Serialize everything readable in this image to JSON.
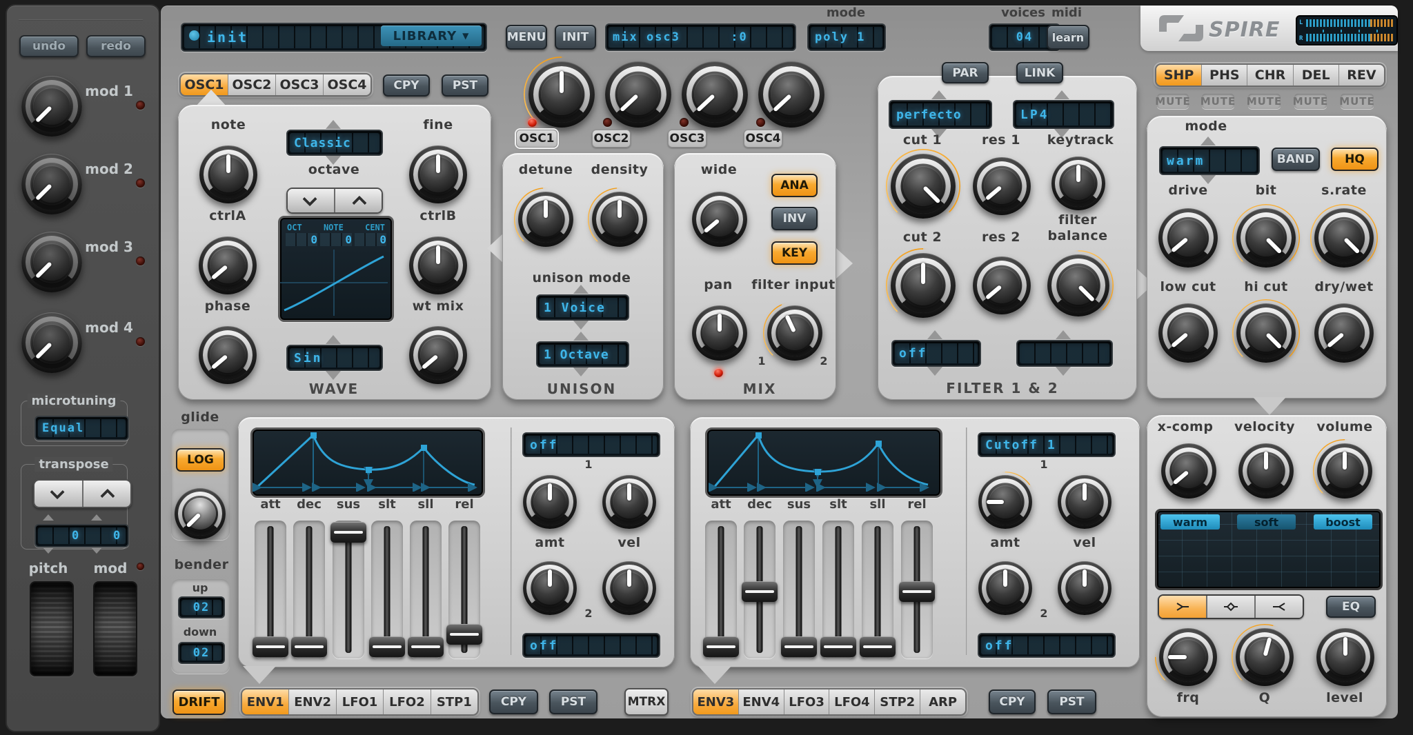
{
  "colors": {
    "accent_orange": "#f29a12",
    "lcd_cyan": "#3fb6ea",
    "lcd_bg": "#0c161d",
    "panel_gray": "#d6d6d6",
    "sidebar_gray": "#4b4b4b"
  },
  "sidebar": {
    "undo": "undo",
    "redo": "redo",
    "mods": [
      "mod 1",
      "mod 2",
      "mod 3",
      "mod 4"
    ],
    "microtuning_label": "microtuning",
    "microtuning_value": "Equal",
    "transpose_label": "transpose",
    "transpose_left": "0",
    "transpose_right": "0",
    "pitch_label": "pitch",
    "mod_label": "mod"
  },
  "topbar": {
    "preset": "init",
    "library": "LIBRARY",
    "library_caret": "▼",
    "menu": "MENU",
    "init": "INIT",
    "info": "mix osc3      :0",
    "mode_label": "mode",
    "mode_value": "poly 1",
    "voices_label": "voices",
    "voices_value": "04",
    "midi_label": "midi",
    "learn": "learn"
  },
  "logo": {
    "brand": "SPIRE",
    "meter_left": "L",
    "meter_right": "R"
  },
  "osc": {
    "tabs": [
      "OSC1",
      "OSC2",
      "OSC3",
      "OSC4"
    ],
    "copy": "CPY",
    "paste": "PST",
    "mixer_labels": [
      "OSC1",
      "OSC2",
      "OSC3",
      "OSC4"
    ],
    "panel": {
      "note": "note",
      "octave": "octave",
      "fine": "fine",
      "ctrl_a": "ctrlA",
      "ctrl_b": "ctrlB",
      "phase": "phase",
      "wt_mix": "wt mix",
      "footer": "WAVE",
      "wave_mode": "Classic",
      "wave_name": "Sin",
      "analyzer": {
        "col_oct": "OCT",
        "col_note": "NOTE",
        "col_cent": "CENT",
        "val_oct": "0",
        "val_note": "0",
        "val_cent": "0"
      }
    }
  },
  "unison": {
    "detune": "detune",
    "density": "density",
    "mode_label": "unison mode",
    "mode_value": "1 Voice",
    "range_value": "1 Octave",
    "footer": "UNISON"
  },
  "mix": {
    "wide": "wide",
    "ana": "ANA",
    "inv": "INV",
    "key": "KEY",
    "pan": "pan",
    "filter_input": "filter input",
    "input_1": "1",
    "input_2": "2",
    "footer": "MIX"
  },
  "filter": {
    "par": "PAR",
    "link": "LINK",
    "type_1": "perfecto",
    "type_2": "LP4",
    "cut_1": "cut 1",
    "res_1": "res 1",
    "keytrack": "keytrack",
    "cut_2": "cut 2",
    "res_2": "res 2",
    "balance_line_1": "filter",
    "balance_line_2": "balance",
    "routing_1": "off",
    "routing_2": "",
    "footer": "FILTER 1 & 2"
  },
  "fx": {
    "tabs": [
      "SHP",
      "PHS",
      "CHR",
      "DEL",
      "REV"
    ],
    "mute": "MUTE",
    "mode_label": "mode",
    "mode_value": "warm",
    "band": "BAND",
    "hq": "HQ",
    "drive": "drive",
    "bit": "bit",
    "s_rate": "s.rate",
    "low_cut": "low cut",
    "hi_cut": "hi cut",
    "dry_wet": "dry/wet"
  },
  "out": {
    "x_comp": "x-comp",
    "velocity": "velocity",
    "volume": "volume",
    "shaper_tabs": [
      "warm",
      "soft",
      "boost"
    ],
    "eq": "EQ",
    "frq": "frq",
    "q": "Q",
    "level": "level"
  },
  "glide": {
    "label": "glide",
    "log": "LOG",
    "bender": "bender",
    "up_label": "up",
    "up_value": "02",
    "down_label": "down",
    "down_value": "02",
    "drift": "DRIFT"
  },
  "env": {
    "slider_labels": [
      "att",
      "dec",
      "sus",
      "slt",
      "sll",
      "rel"
    ],
    "amt": "amt",
    "vel": "vel",
    "one": "1",
    "two": "2"
  },
  "env1": {
    "mod_route_top": "off",
    "mod_route_bottom": "off",
    "tabs": [
      "ENV1",
      "ENV2",
      "LFO1",
      "LFO2",
      "STP1"
    ],
    "copy": "CPY",
    "paste": "PST",
    "mtrx": "MTRX"
  },
  "env3": {
    "mod_route_top": "Cutoff 1",
    "mod_route_bottom": "off",
    "tabs": [
      "ENV3",
      "ENV4",
      "LFO3",
      "LFO4",
      "STP2",
      "ARP"
    ],
    "copy": "CPY",
    "paste": "PST"
  }
}
